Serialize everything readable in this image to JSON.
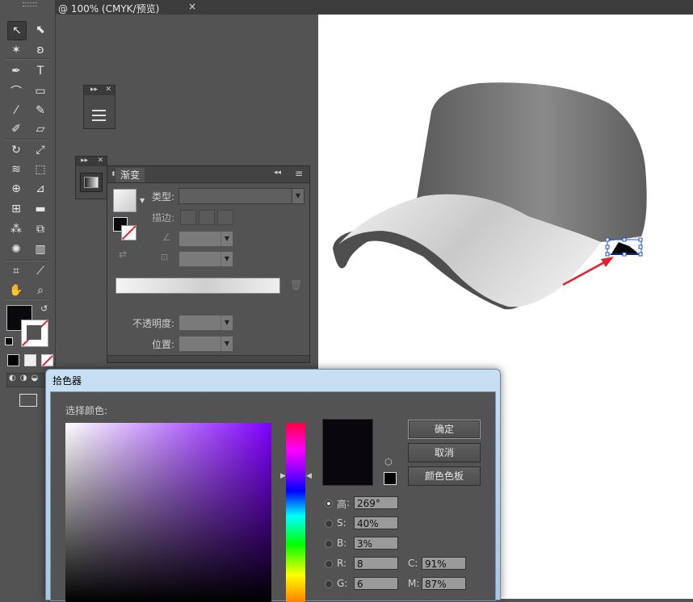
{
  "document": {
    "tab_title": "@ 100% (CMYK/预览)",
    "close_glyph": "×"
  },
  "toolbox": {
    "tools": [
      {
        "name": "selection-tool",
        "glyph": "↖"
      },
      {
        "name": "direct-selection-tool",
        "glyph": "⬉"
      },
      {
        "name": "magic-wand-tool",
        "glyph": "✶"
      },
      {
        "name": "lasso-tool",
        "glyph": "ʚ"
      },
      {
        "name": "pen-tool",
        "glyph": "✒"
      },
      {
        "name": "type-tool",
        "glyph": "T"
      },
      {
        "name": "arc-tool",
        "glyph": "⌒"
      },
      {
        "name": "rectangle-tool",
        "glyph": "▭"
      },
      {
        "name": "paintbrush-tool",
        "glyph": "⁄"
      },
      {
        "name": "pencil-tool",
        "glyph": "✎"
      },
      {
        "name": "blob-brush-tool",
        "glyph": "✐"
      },
      {
        "name": "eraser-tool",
        "glyph": "▱"
      },
      {
        "name": "rotate-tool",
        "glyph": "↻"
      },
      {
        "name": "scale-tool",
        "glyph": "⤢"
      },
      {
        "name": "warp-tool",
        "glyph": "≋"
      },
      {
        "name": "free-transform-tool",
        "glyph": "⬚"
      },
      {
        "name": "shape-builder-tool",
        "glyph": "⊕"
      },
      {
        "name": "perspective-grid-tool",
        "glyph": "⊿"
      },
      {
        "name": "mesh-tool",
        "glyph": "⊞"
      },
      {
        "name": "gradient-tool",
        "glyph": "▬"
      },
      {
        "name": "eyedropper-tool",
        "glyph": "⁂"
      },
      {
        "name": "blend-tool",
        "glyph": "⧉"
      },
      {
        "name": "symbol-sprayer-tool",
        "glyph": "✺"
      },
      {
        "name": "column-graph-tool",
        "glyph": "▥"
      },
      {
        "name": "artboard-tool",
        "glyph": "⌗"
      },
      {
        "name": "slice-tool",
        "glyph": "⟋"
      },
      {
        "name": "hand-tool",
        "glyph": "✋"
      },
      {
        "name": "zoom-tool",
        "glyph": "⌕"
      }
    ]
  },
  "gradient_panel": {
    "tab_label": "渐变",
    "type_label": "类型:",
    "stroke_label": "描边:",
    "opacity_label": "不透明度:",
    "location_label": "位置:",
    "menu_glyph": "≡",
    "collapse_glyph": "◂◂"
  },
  "color_picker": {
    "title": "拾色器",
    "select_color_label": "选择颜色:",
    "ok_label": "确定",
    "cancel_label": "取消",
    "swatches_label": "颜色色板",
    "hsb": [
      {
        "label": "H:",
        "value": "269°",
        "selected": true
      },
      {
        "label": "S:",
        "value": "40%",
        "selected": false
      },
      {
        "label": "B:",
        "value": "3%",
        "selected": false
      }
    ],
    "rgb": [
      {
        "label": "R:",
        "value": "8"
      },
      {
        "label": "G:",
        "value": "6"
      }
    ],
    "cmyk": [
      {
        "label": "C:",
        "value": "91%"
      },
      {
        "label": "M:",
        "value": "87%"
      }
    ],
    "current_color": "#09070d",
    "h_prefix_char": "高"
  },
  "colors": {
    "accent_red": "#e5202a",
    "selection_blue": "#1a53c9"
  }
}
